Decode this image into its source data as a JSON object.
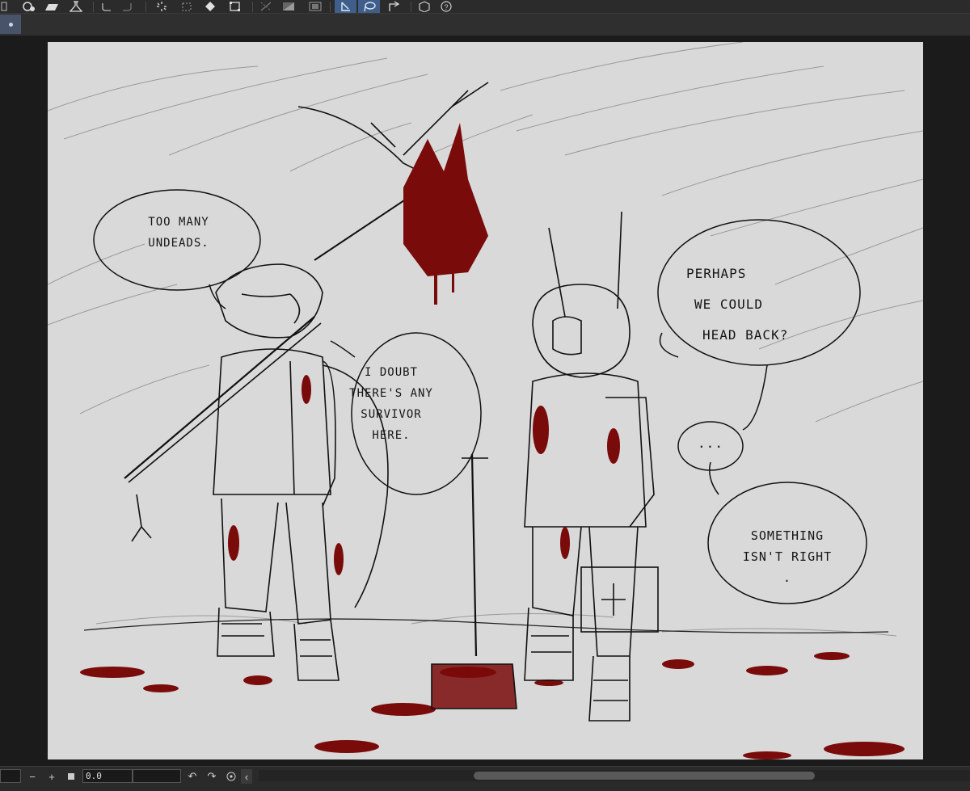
{
  "toolbar": {
    "icons": [
      "new-layer-icon",
      "open-icon",
      "save-icon",
      "flask-icon",
      "undo-icon",
      "redo-icon",
      "loading-icon",
      "transform-icon",
      "fill-icon",
      "crop-icon",
      "ruler-icon",
      "gradient-icon",
      "filmstrip-icon",
      "select-icon",
      "lasso-icon",
      "export-icon",
      "3d-icon",
      "help-icon"
    ],
    "active": [
      "select-icon",
      "lasso-icon"
    ]
  },
  "canvas": {
    "speech_bubbles": [
      {
        "id": "too-many-undeads",
        "lines": [
          "TOO MANY",
          "UNDEADS."
        ]
      },
      {
        "id": "i-doubt",
        "lines": [
          "I DOUBT",
          "THERE'S ANY",
          "SURVIVOR",
          "HERE."
        ]
      },
      {
        "id": "perhaps",
        "lines": [
          "PERHAPS",
          "WE COULD",
          "HEAD BACK?"
        ]
      },
      {
        "id": "ellipsis",
        "lines": [
          "..."
        ]
      },
      {
        "id": "something",
        "lines": [
          "SOMETHING",
          "ISN'T RIGHT",
          "."
        ]
      }
    ],
    "colors": {
      "paper": "#d9d9d9",
      "ink": "#111111",
      "blood": "#7a0b0b"
    }
  },
  "bottom_bar": {
    "angle_value": "0.0",
    "buttons": [
      "zoom-out-icon",
      "zoom-in-icon",
      "fit-icon",
      "rotate-left-icon",
      "rotate-right-icon",
      "reset-rotation-icon",
      "flip-icon"
    ]
  }
}
